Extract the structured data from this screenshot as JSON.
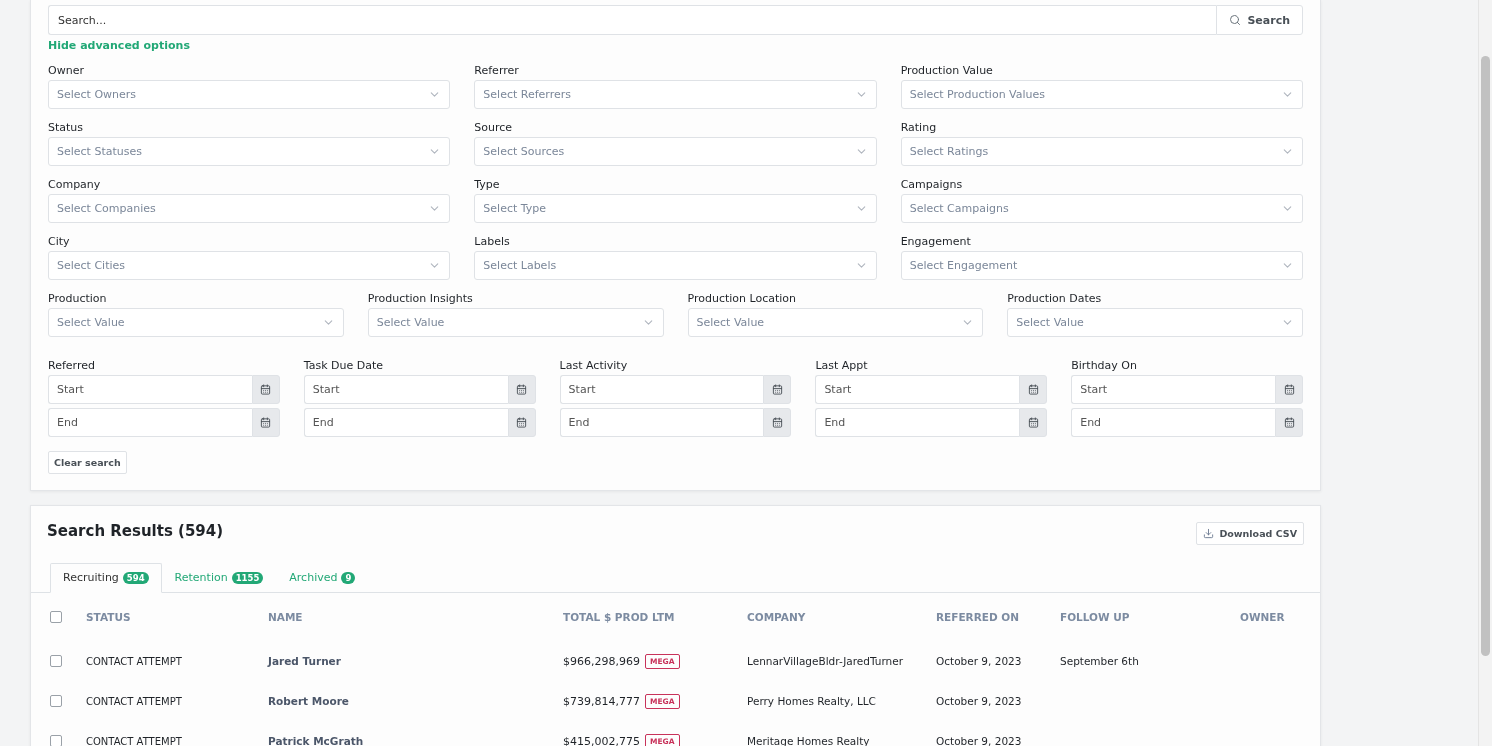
{
  "search": {
    "placeholder": "Search...",
    "button": "Search"
  },
  "toggle_link": "Hide advanced options",
  "filters": [
    {
      "label": "Owner",
      "placeholder": "Select Owners"
    },
    {
      "label": "Referrer",
      "placeholder": "Select Referrers"
    },
    {
      "label": "Production Value",
      "placeholder": "Select Production Values"
    },
    {
      "label": "Status",
      "placeholder": "Select Statuses"
    },
    {
      "label": "Source",
      "placeholder": "Select Sources"
    },
    {
      "label": "Rating",
      "placeholder": "Select Ratings"
    },
    {
      "label": "Company",
      "placeholder": "Select Companies"
    },
    {
      "label": "Type",
      "placeholder": "Select Type"
    },
    {
      "label": "Campaigns",
      "placeholder": "Select Campaigns"
    },
    {
      "label": "City",
      "placeholder": "Select Cities"
    },
    {
      "label": "Labels",
      "placeholder": "Select Labels"
    },
    {
      "label": "Engagement",
      "placeholder": "Select Engagement"
    }
  ],
  "production_filters": [
    {
      "label": "Production",
      "placeholder": "Select Value"
    },
    {
      "label": "Production Insights",
      "placeholder": "Select Value"
    },
    {
      "label": "Production Location",
      "placeholder": "Select Value"
    },
    {
      "label": "Production Dates",
      "placeholder": "Select Value"
    }
  ],
  "date_filters": [
    {
      "label": "Referred",
      "start_placeholder": "Start",
      "end_placeholder": "End"
    },
    {
      "label": "Task Due Date",
      "start_placeholder": "Start",
      "end_placeholder": "End"
    },
    {
      "label": "Last Activity",
      "start_placeholder": "Start",
      "end_placeholder": "End"
    },
    {
      "label": "Last Appt",
      "start_placeholder": "Start",
      "end_placeholder": "End"
    },
    {
      "label": "Birthday On",
      "start_placeholder": "Start",
      "end_placeholder": "End"
    }
  ],
  "clear_button": "Clear search",
  "results": {
    "title": "Search Results (594)",
    "download_button": "Download CSV",
    "tabs": [
      {
        "label": "Recruiting",
        "count": "594",
        "selected": true
      },
      {
        "label": "Retention",
        "count": "1155",
        "selected": false
      },
      {
        "label": "Archived",
        "count": "9",
        "selected": false
      }
    ],
    "select_all_checked": false,
    "columns": [
      "STATUS",
      "NAME",
      "TOTAL $ PROD LTM",
      "COMPANY",
      "REFERRED ON",
      "FOLLOW UP",
      "OWNER"
    ],
    "rows": [
      {
        "checked": false,
        "status": "CONTACT ATTEMPT",
        "name": "Jared Turner",
        "total": "$966,298,969",
        "tag": "MEGA",
        "company": "LennarVillageBldr-JaredTurner",
        "referred_on": "October 9, 2023",
        "follow_up": "September 6th"
      },
      {
        "checked": false,
        "status": "CONTACT ATTEMPT",
        "name": "Robert Moore",
        "total": "$739,814,777",
        "tag": "MEGA",
        "company": "Perry Homes Realty, LLC",
        "referred_on": "October 9, 2023"
      },
      {
        "checked": false,
        "status": "CONTACT ATTEMPT",
        "name": "Patrick McGrath",
        "total": "$415,002,775",
        "tag": "MEGA",
        "company": "Meritage Homes Realty",
        "referred_on": "October 9, 2023"
      }
    ]
  }
}
